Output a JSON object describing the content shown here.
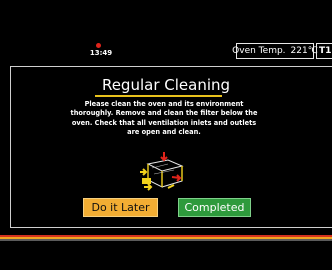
{
  "status_bar": {
    "time": "13:49",
    "oven_temp_label": "Oven Temp.",
    "oven_temp_value": "221℃",
    "tray_label": "T1"
  },
  "dialog": {
    "title": "Regular Cleaning",
    "message": "Please clean the oven and its environment thoroughly. Remove and clean the filter below the oven. Check that all ventilation inlets and outlets are open and clean.",
    "illustration_icon": "oven-cleaning-illustration-icon",
    "buttons": {
      "later_label": "Do it Later",
      "completed_label": "Completed"
    }
  },
  "colors": {
    "background": "#000000",
    "accent_yellow": "#e8c21c",
    "later_button": "#f2ad33",
    "completed_button": "#2e9a3c",
    "alarm_dot": "#e0241b"
  }
}
